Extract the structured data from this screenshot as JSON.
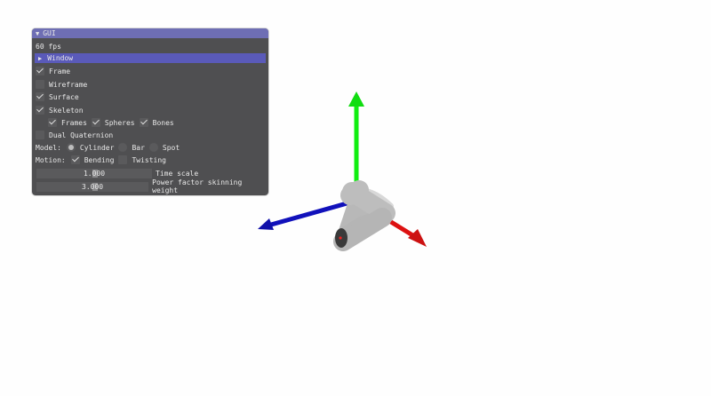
{
  "gui": {
    "title": "GUI",
    "fps": "60 fps",
    "window_label": "Window",
    "options": {
      "frame": {
        "label": "Frame",
        "checked": true
      },
      "wireframe": {
        "label": "Wireframe",
        "checked": false
      },
      "surface": {
        "label": "Surface",
        "checked": true
      },
      "skeleton": {
        "label": "Skeleton",
        "checked": true
      },
      "frames": {
        "label": "Frames",
        "checked": true
      },
      "spheres": {
        "label": "Spheres",
        "checked": true
      },
      "bones": {
        "label": "Bones",
        "checked": true
      },
      "dual_quaternion": {
        "label": "Dual Quaternion",
        "checked": false
      }
    },
    "model": {
      "label": "Model:",
      "options": [
        "Cylinder",
        "Bar",
        "Spot"
      ],
      "selected": "Cylinder"
    },
    "motion": {
      "label": "Motion:",
      "bending": {
        "label": "Bending",
        "checked": true
      },
      "twisting": {
        "label": "Twisting",
        "checked": false
      }
    },
    "time_scale": {
      "value": "1.000",
      "label": "Time scale"
    },
    "power_factor": {
      "value": "3.000",
      "label": "Power factor skinning weight"
    }
  },
  "scene": {
    "axis_colors": {
      "x": "#dd1111",
      "y": "#11ee11",
      "z": "#1111bb"
    },
    "model_color": "#b8b8b8"
  }
}
